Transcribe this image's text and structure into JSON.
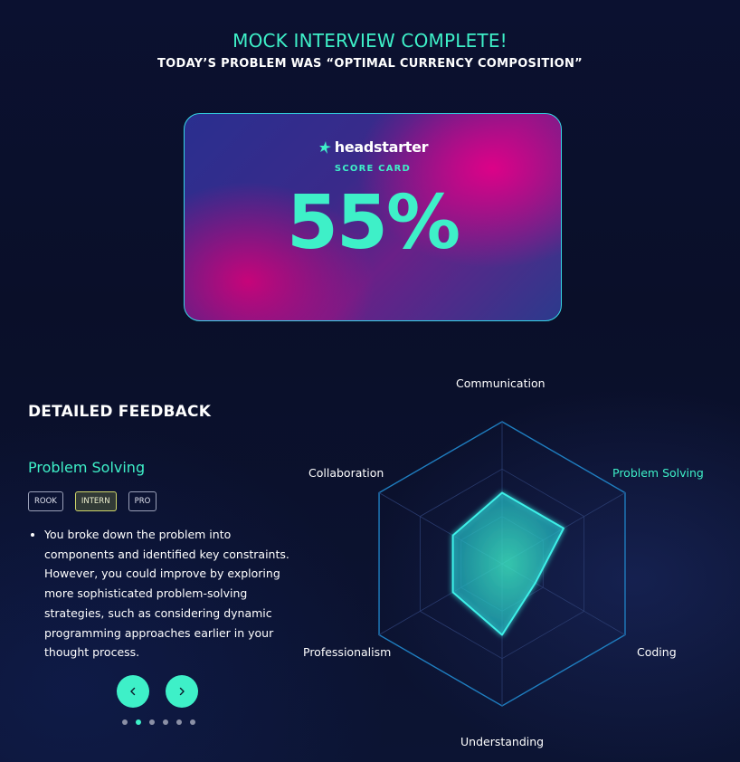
{
  "header": {
    "title": "MOCK INTERVIEW COMPLETE!",
    "subtitle": "TODAY’S PROBLEM WAS “OPTIMAL CURRENCY COMPOSITION”"
  },
  "score_card": {
    "brand": "headstarter",
    "label": "SCORE CARD",
    "score": "55%"
  },
  "feedback": {
    "title": "DETAILED FEEDBACK",
    "category": "Problem Solving",
    "levels": [
      "ROOK",
      "INTERN",
      "PRO"
    ],
    "selected_level": "INTERN",
    "bullets": [
      "You broke down the problem into components and identified key constraints. However, you could improve by exploring more sophisticated problem-solving strategies, such as considering dynamic programming approaches earlier in your thought process."
    ],
    "carousel": {
      "current_index": 2,
      "total": 6
    }
  },
  "radar": {
    "labels": {
      "communication": "Communication",
      "problem_solving": "Problem Solving",
      "coding": "Coding",
      "understanding": "Understanding",
      "professionalism": "Professionalism",
      "collaboration": "Collaboration"
    },
    "highlighted": "Problem Solving",
    "axes": [
      "Communication",
      "Problem Solving",
      "Coding",
      "Understanding",
      "Professionalism",
      "Collaboration"
    ],
    "values": [
      0.5,
      0.5,
      0.27,
      0.5,
      0.4,
      0.4
    ],
    "accent_color": "#3ef0c8",
    "grid_color": "#1f7ec0"
  }
}
